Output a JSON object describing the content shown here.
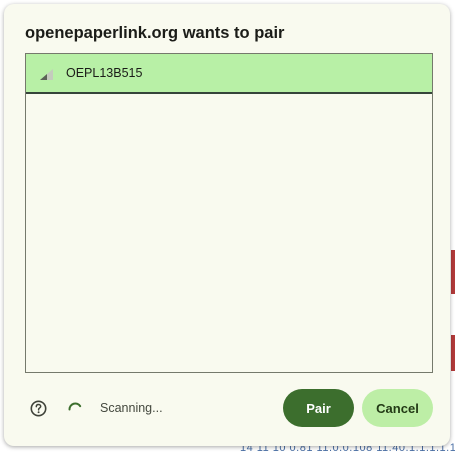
{
  "dialog": {
    "title": "openepaperlink.org wants to pair"
  },
  "devices": [
    {
      "name": "OEPL13B515",
      "selected": true
    }
  ],
  "footer": {
    "status_text": "Scanning...",
    "pair_label": "Pair",
    "cancel_label": "Cancel"
  },
  "background": {
    "snippet": "14 11 10 0.81 11.0.0.108 11.40.1.1.1.1.1"
  },
  "colors": {
    "dialog_bg": "#f9faef",
    "selected_row": "#b8f0a6",
    "primary_button": "#3c6e2d",
    "secondary_button": "#bdeea6",
    "spinner": "#3c6e2d"
  },
  "icons": {
    "help": "help-circle-icon",
    "spinner": "loading-spinner-icon",
    "signal": "signal-strength-icon"
  }
}
